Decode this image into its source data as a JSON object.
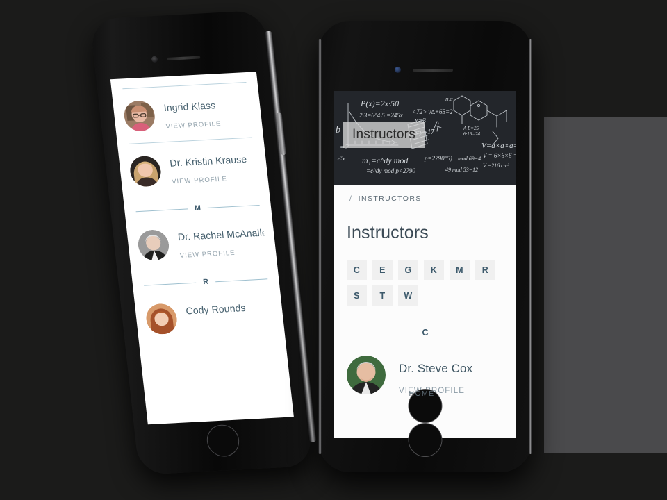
{
  "hero": {
    "badge_label": "Instructors",
    "background_description": "chalkboard-equations"
  },
  "breadcrumb": {
    "home_label": "HOME",
    "separator": "/",
    "current_label": "INSTRUCTORS"
  },
  "page": {
    "title": "Instructors"
  },
  "alphabet_filter": {
    "row1": [
      "C",
      "E",
      "G",
      "K",
      "M",
      "R"
    ],
    "row2": [
      "S",
      "T",
      "W"
    ]
  },
  "right_phone": {
    "sections": [
      {
        "letter": "C",
        "people": [
          {
            "name": "Dr. Steve Cox",
            "link_label": "VIEW PROFILE",
            "avatar_bg": "#3f6b3e"
          }
        ]
      }
    ]
  },
  "left_phone": {
    "entries": [
      {
        "type": "person",
        "name": "Ingrid Klass",
        "link_label": "VIEW PROFILE",
        "avatar_bg": "#b08a74"
      },
      {
        "type": "person",
        "name": "Dr. Kristin Krause",
        "link_label": "VIEW PROFILE",
        "avatar_bg": "#8c7155"
      },
      {
        "type": "section",
        "letter": "M"
      },
      {
        "type": "person",
        "name": "Dr. Rachel McAnallen",
        "link_label": "VIEW PROFILE",
        "avatar_bg": "#8e8e8e"
      },
      {
        "type": "section",
        "letter": "R"
      },
      {
        "type": "person",
        "name": "Cody Rounds",
        "link_label": "",
        "avatar_bg": "#a0522d"
      }
    ]
  },
  "colors": {
    "accent": "#3d5a6c",
    "name_text": "#3f5663",
    "link_text": "#8a9aa5",
    "rule": "#9fc0cf",
    "chip_bg": "#f0f0f0",
    "page_bg": "#fcfcfc",
    "backdrop": "#1b1b1a",
    "panel": "#4a4a4c"
  }
}
